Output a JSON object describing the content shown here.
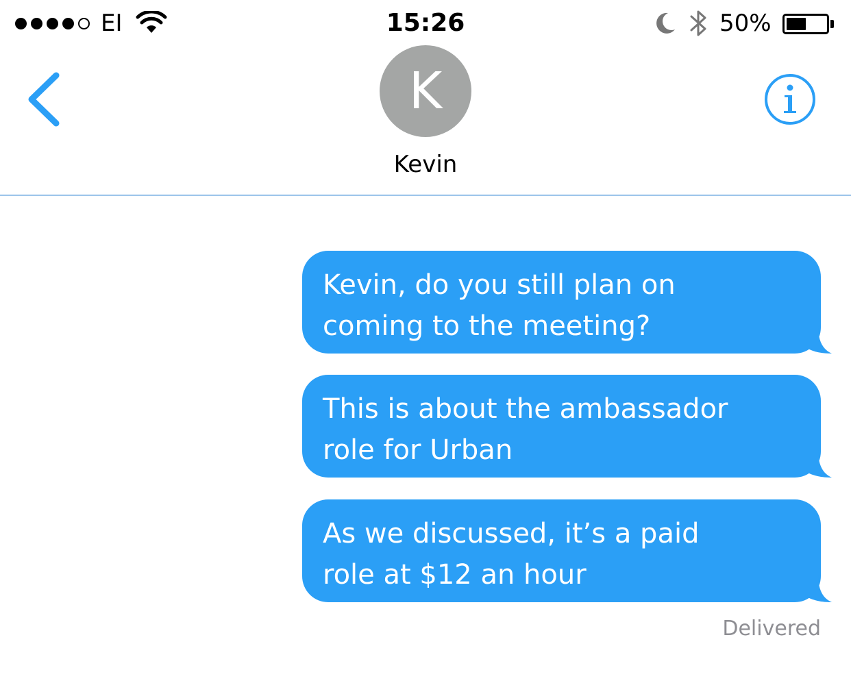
{
  "status_bar": {
    "signal_filled": 4,
    "signal_total": 5,
    "carrier": "EI",
    "time": "15:26",
    "battery_percent_label": "50%",
    "battery_level": 0.5
  },
  "header": {
    "avatar_initial": "K",
    "contact_name": "Kevin",
    "accent_color": "#2b9ff6"
  },
  "messages": [
    {
      "text": "Kevin, do you still plan on\ncoming to the meeting?"
    },
    {
      "text": "This is about the ambassador\nrole for Urban"
    },
    {
      "text": "As we discussed, it’s a paid\nrole at $12 an hour"
    }
  ],
  "delivery_status": "Delivered"
}
